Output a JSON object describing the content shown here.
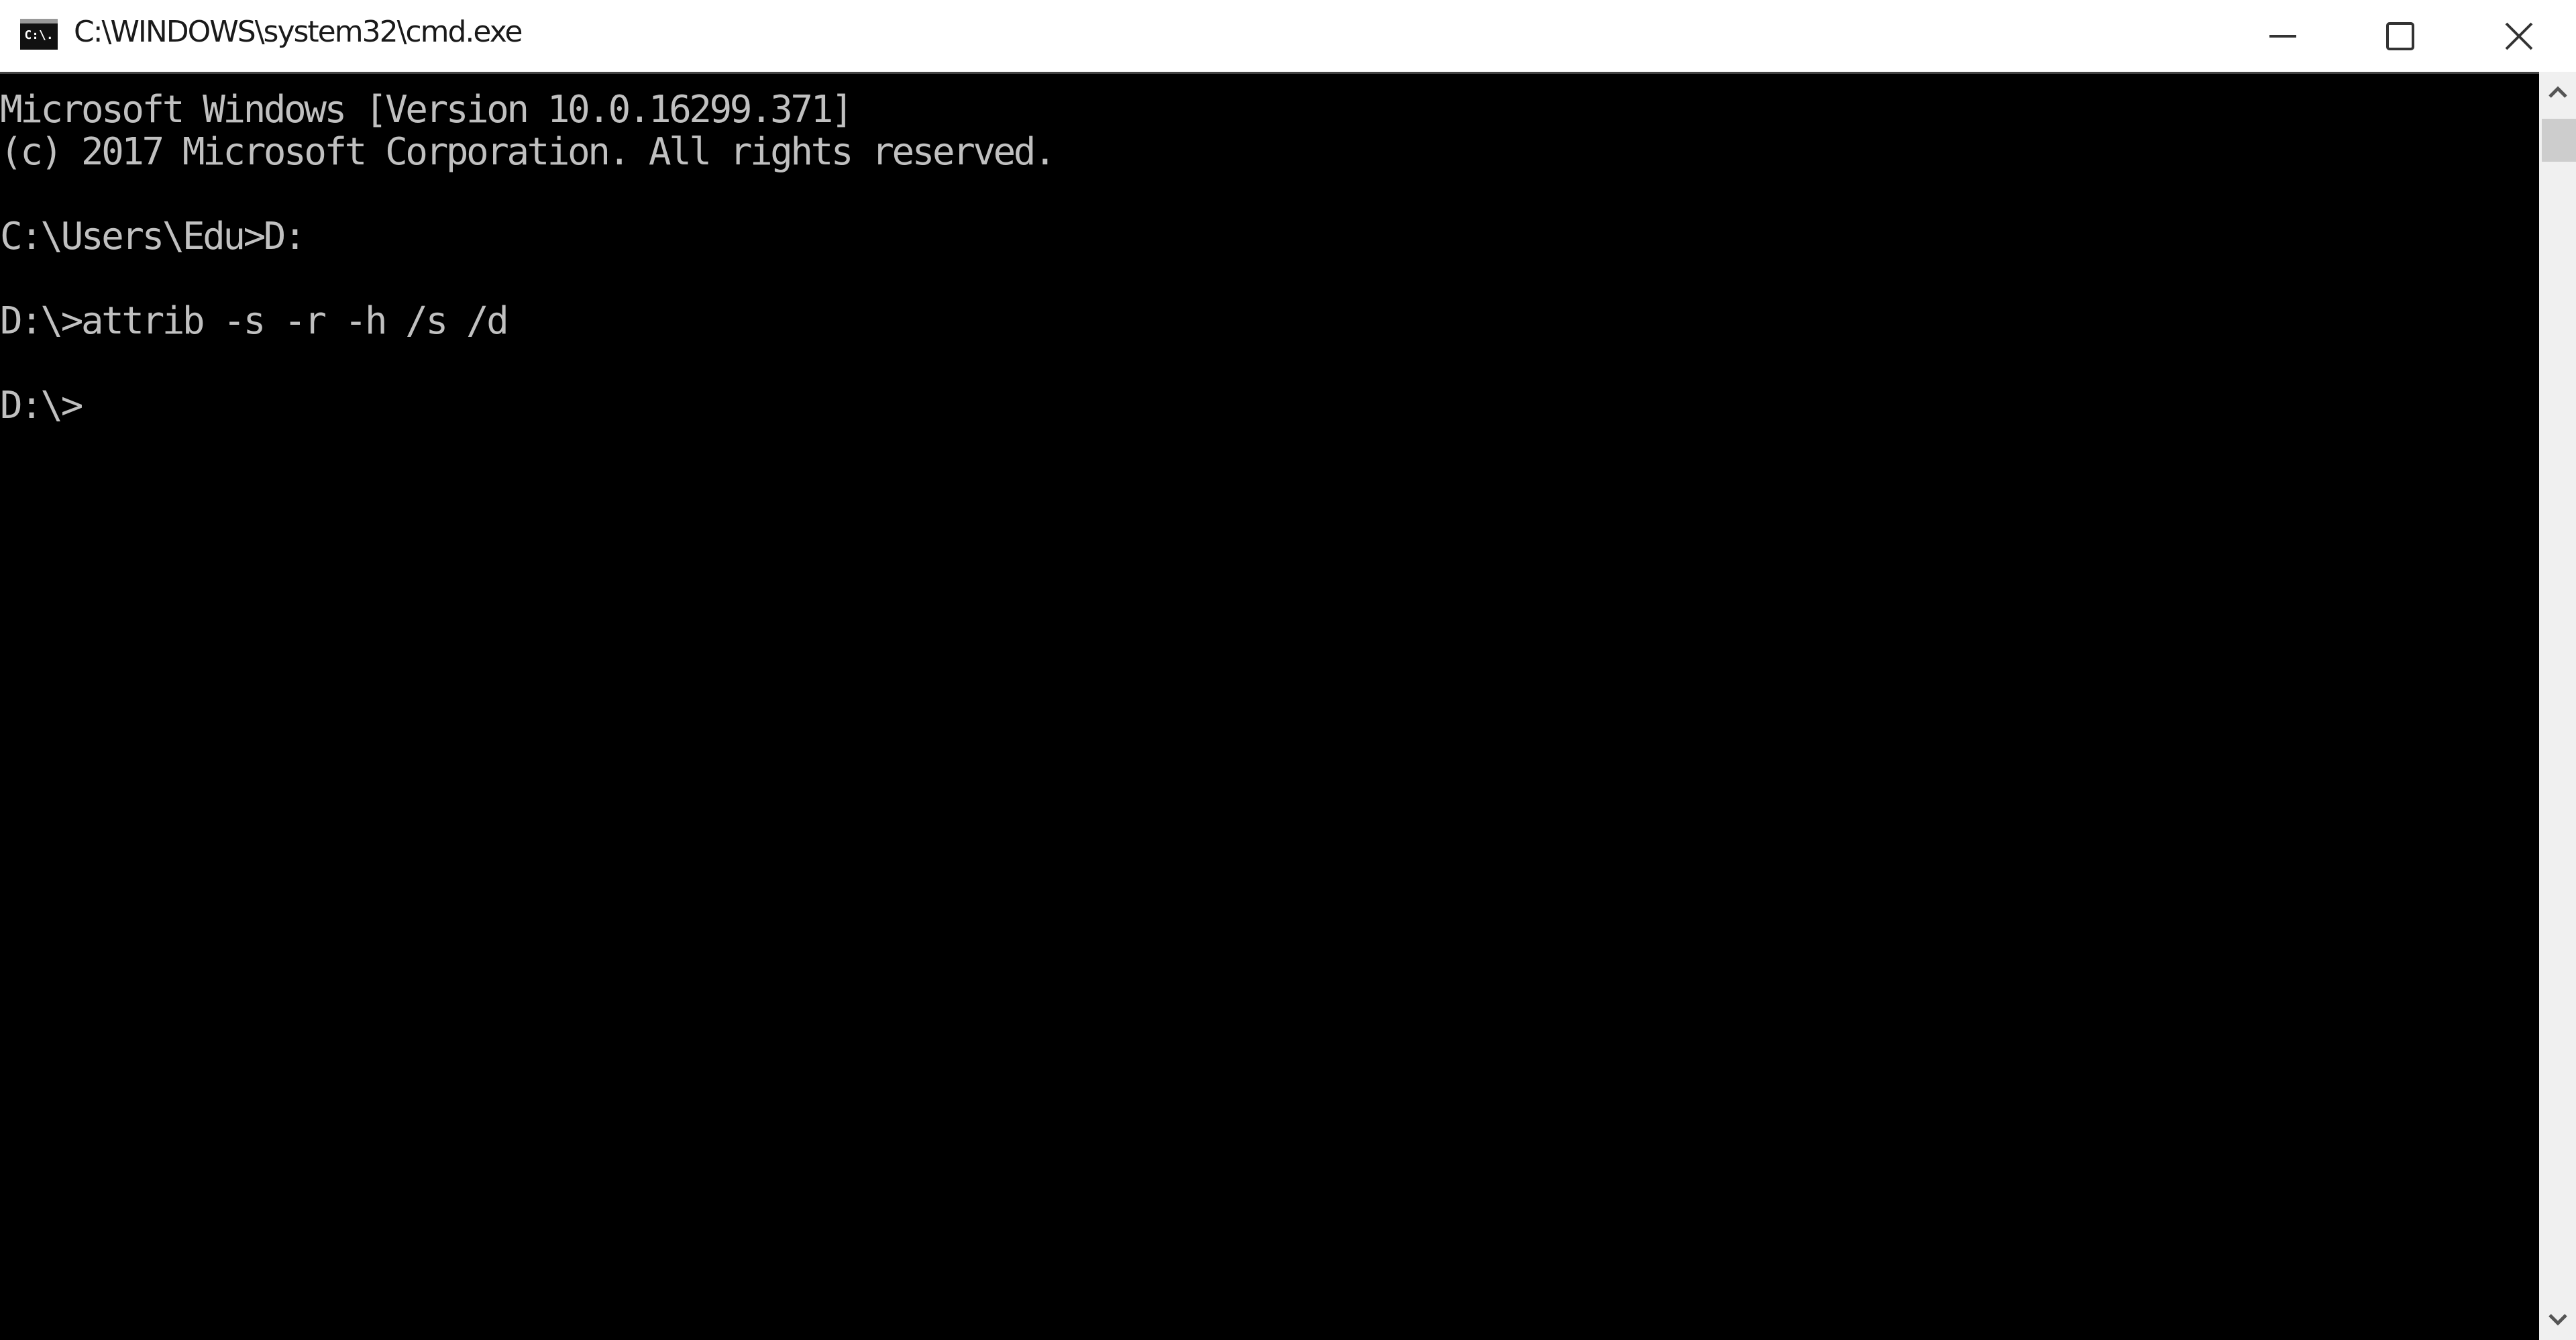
{
  "window": {
    "title": "C:\\WINDOWS\\system32\\cmd.exe",
    "icon": "cmd-app-icon",
    "icon_text": "C:\\.",
    "controls": [
      "minimize-icon",
      "maximize-icon",
      "close-icon"
    ]
  },
  "console": {
    "background": "#000000",
    "foreground": "#c0c0c0",
    "lines": [
      "Microsoft Windows [Version 10.0.16299.371]",
      "(c) 2017 Microsoft Corporation. All rights reserved.",
      "",
      "C:\\Users\\Edu>D:",
      "",
      "D:\\>attrib -s -r -h /s /d",
      "",
      "D:\\>"
    ]
  },
  "scrollbar": {
    "up_icon": "chevron-up-icon",
    "down_icon": "chevron-down-icon"
  }
}
